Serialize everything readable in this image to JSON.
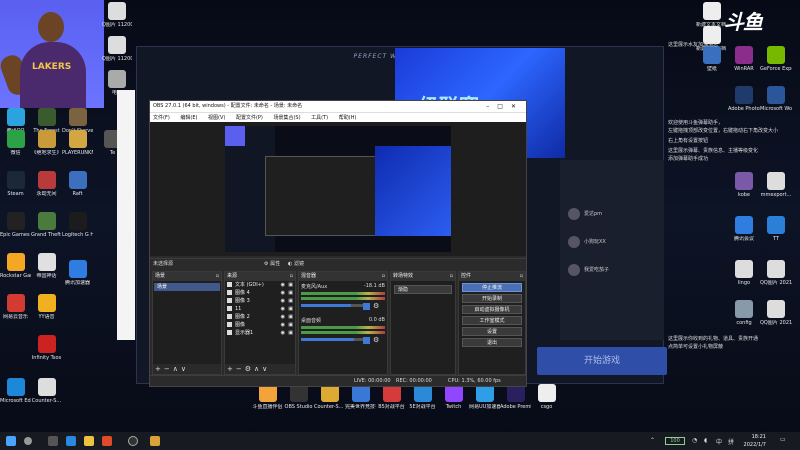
{
  "desktop": {
    "left_icons": [
      {
        "label": "腾讯QQ",
        "color": "#2aa3e0"
      },
      {
        "label": "The Forest",
        "color": "#3b5b2e"
      },
      {
        "label": "Don't Starve Together",
        "color": "#7b6240"
      },
      {
        "label": "微信",
        "color": "#2ba245"
      },
      {
        "label": "《绝地求生》",
        "color": "#c89a3a"
      },
      {
        "label": "PLAYERUNKNOWN'S BATTLEGR...",
        "color": "#d2a642"
      },
      {
        "label": "Te",
        "color": "#555555"
      },
      {
        "label": "Steam",
        "color": "#1b2838"
      },
      {
        "label": "永劫无间",
        "color": "#b83a3a"
      },
      {
        "label": "Raft",
        "color": "#3d6fbf"
      },
      {
        "label": "Epic Games Launcher",
        "color": "#222222"
      },
      {
        "label": "Grand Theft Auto V",
        "color": "#4a7a3c"
      },
      {
        "label": "Logitech G HUB",
        "color": "#1c1c1c"
      },
      {
        "label": "Rockstar Games...",
        "color": "#f5a623"
      },
      {
        "label": "帝国神话",
        "color": "#e0e0e0"
      },
      {
        "label": "网易云音乐",
        "color": "#d33a31"
      },
      {
        "label": "YY语音",
        "color": "#f0b020"
      },
      {
        "label": "腾讯加速器",
        "color": "#2f7de1"
      },
      {
        "label": "Infinity Tsos",
        "color": "#cc2222"
      },
      {
        "label": "Microsoft Edge",
        "color": "#1e88d8"
      },
      {
        "label": "Counter-S...",
        "color": "#dddddd"
      }
    ],
    "top_mid_icons": [
      {
        "label": "Q图片 11200...",
        "color": "#dddddd"
      },
      {
        "label": "Q图片 11200...",
        "color": "#dddddd"
      },
      {
        "label": "电脑",
        "color": "#aaaaaa"
      }
    ],
    "right_icons": [
      {
        "label": "新建文本文档.txt",
        "color": "#eeeeee"
      },
      {
        "label": "新建文本文档 (2).txt",
        "color": "#eeeeee"
      },
      {
        "label": "壁纸",
        "color": "#3a6fbf"
      },
      {
        "label": "WinRAR",
        "color": "#8b2d8b"
      },
      {
        "label": "GeForce Experience",
        "color": "#76b900"
      },
      {
        "label": "Adobe Photosh...",
        "color": "#1f3a6b"
      },
      {
        "label": "Microsoft Word",
        "color": "#2b579a"
      },
      {
        "label": "kobe",
        "color": "#7a5aa8"
      },
      {
        "label": "mmexport...",
        "color": "#dddddd"
      },
      {
        "label": "腾讯会议",
        "color": "#2f7de1"
      },
      {
        "label": "TT",
        "color": "#2a7fd6"
      },
      {
        "label": "lingo",
        "color": "#dddddd"
      },
      {
        "label": "QQ图片 20210801...",
        "color": "#dddddd"
      },
      {
        "label": "config",
        "color": "#8899aa"
      },
      {
        "label": "QQ图片 20210901...",
        "color": "#dddddd"
      }
    ],
    "right_notes": [
      "这里展示水友加油消息",
      "欢迎使用斗鱼弹幕助手，",
      "左键拖拽顶部改变位置，右键拖动右下角改变大小",
      "右上角有设置按钮",
      "这里展示弹幕、贵族信息、主播等级变化",
      "添加弹幕助手成功",
      "这里展示你收到的礼物、道具、贵族开通",
      "点简单可设置小礼物屏蔽"
    ],
    "bottom_icons": [
      {
        "label": "斗鱼直播伴侣",
        "color": "#f2a43a"
      },
      {
        "label": "OBS Studio",
        "color": "#333333"
      },
      {
        "label": "Counter-S... Global Off...",
        "color": "#ddaa33"
      },
      {
        "label": "完美世界竞技平台",
        "color": "#3a78d8"
      },
      {
        "label": "B5对战平台",
        "color": "#d63a3a"
      },
      {
        "label": "5E对战平台",
        "color": "#2a8ad8"
      },
      {
        "label": "Twitch",
        "color": "#9146ff"
      },
      {
        "label": "网易UU加速器",
        "color": "#2f9ee8"
      },
      {
        "label": "Adobe Premie...",
        "color": "#2a1f5f"
      },
      {
        "label": "csgo",
        "color": "#eeeeee"
      }
    ],
    "logo": "斗鱼"
  },
  "game": {
    "title": "PERFECT WORLD ARENA",
    "banner_text": "级联赛",
    "users": [
      "爱达pm",
      "小狗玩XX",
      "我爱吃茄子"
    ],
    "start_button": "开始游戏"
  },
  "obs": {
    "title": "OBS 27.0.1 (64 bit, windows) - 配置文件: 未命名 - 场景: 未命名",
    "menu": [
      "文件(F)",
      "编辑(E)",
      "视图(V)",
      "配置文件(P)",
      "场景集合(S)",
      "工具(T)",
      "帮助(H)"
    ],
    "context_bar": {
      "no_source": "未选择源",
      "properties": "属性",
      "filters": "滤镜"
    },
    "docks": {
      "scenes": {
        "title": "场景",
        "items": [
          "场景"
        ]
      },
      "sources": {
        "title": "来源",
        "items": [
          "文本 (GDI+)",
          "图像 4",
          "图像 3",
          "11",
          "图像 2",
          "图像",
          "显示器1"
        ]
      },
      "mixer": {
        "title": "混音器",
        "tracks": [
          {
            "name": "麦克风/Aux",
            "db": "-18.1 dB",
            "level": 0.8
          },
          {
            "name": "桌面音频",
            "db": "0.0 dB",
            "level": 0.85
          }
        ]
      },
      "transitions": {
        "title": "转场特效",
        "selected": "渐隐"
      },
      "controls": {
        "title": "控件",
        "buttons": [
          "停止推流",
          "开始录制",
          "启动虚拟摄像机",
          "工作室模式",
          "设置",
          "退出"
        ]
      }
    },
    "status": {
      "live": "LIVE: 00:00:00",
      "rec": "REC: 00:00:00",
      "cpu": "CPU: 1.3%, 60.00 fps"
    }
  },
  "taskbar": {
    "clock_time": "18:21",
    "clock_date": "2022/1/7",
    "battery": "100"
  }
}
